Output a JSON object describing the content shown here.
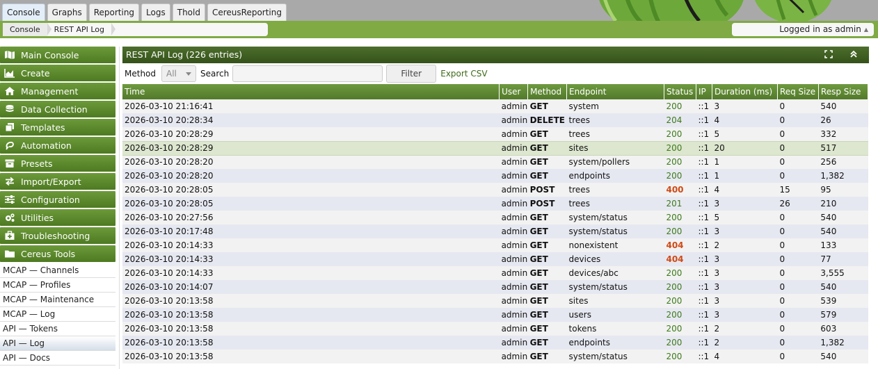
{
  "tabs": [
    "Console",
    "Graphs",
    "Reporting",
    "Logs",
    "Thold",
    "CereusReporting"
  ],
  "breadcrumb": [
    "Console",
    "REST API Log"
  ],
  "login": {
    "text": "Logged in as admin"
  },
  "nav": [
    {
      "label": "Main Console",
      "icon": "map-icon"
    },
    {
      "label": "Create",
      "icon": "chart-area-icon"
    },
    {
      "label": "Management",
      "icon": "home-icon"
    },
    {
      "label": "Data Collection",
      "icon": "database-icon"
    },
    {
      "label": "Templates",
      "icon": "clone-icon"
    },
    {
      "label": "Automation",
      "icon": "automation-icon"
    },
    {
      "label": "Presets",
      "icon": "archive-icon"
    },
    {
      "label": "Import/Export",
      "icon": "exchange-icon"
    },
    {
      "label": "Configuration",
      "icon": "sliders-icon"
    },
    {
      "label": "Utilities",
      "icon": "cogs-icon"
    },
    {
      "label": "Troubleshooting",
      "icon": "medkit-icon"
    },
    {
      "label": "Cereus Tools",
      "icon": "folder-icon"
    }
  ],
  "subnav": [
    "MCAP — Channels",
    "MCAP — Profiles",
    "MCAP — Maintenance",
    "MCAP — Log",
    "API — Tokens",
    "API — Log",
    "API — Docs"
  ],
  "panel": {
    "title": "REST API Log (226 entries)"
  },
  "filter": {
    "method_label": "Method",
    "method_value": "All",
    "search_label": "Search",
    "search_value": "",
    "filter_button": "Filter",
    "export_link": "Export CSV"
  },
  "columns": [
    "Time",
    "User",
    "Method",
    "Endpoint",
    "Status",
    "IP",
    "Duration (ms)",
    "Req Size",
    "Resp Size"
  ],
  "rows": [
    [
      "2026-03-10 21:16:41",
      "admin",
      "GET",
      "system",
      "200",
      "::1",
      "3",
      "0",
      "540"
    ],
    [
      "2026-03-10 20:28:34",
      "admin",
      "DELETE",
      "trees",
      "204",
      "::1",
      "4",
      "0",
      "26"
    ],
    [
      "2026-03-10 20:28:29",
      "admin",
      "GET",
      "trees",
      "200",
      "::1",
      "5",
      "0",
      "332"
    ],
    [
      "2026-03-10 20:28:29",
      "admin",
      "GET",
      "sites",
      "200",
      "::1",
      "20",
      "0",
      "517"
    ],
    [
      "2026-03-10 20:28:20",
      "admin",
      "GET",
      "system/pollers",
      "200",
      "::1",
      "1",
      "0",
      "256"
    ],
    [
      "2026-03-10 20:28:20",
      "admin",
      "GET",
      "endpoints",
      "200",
      "::1",
      "1",
      "0",
      "1,382"
    ],
    [
      "2026-03-10 20:28:05",
      "admin",
      "POST",
      "trees",
      "400",
      "::1",
      "4",
      "15",
      "95"
    ],
    [
      "2026-03-10 20:28:05",
      "admin",
      "POST",
      "trees",
      "201",
      "::1",
      "3",
      "26",
      "210"
    ],
    [
      "2026-03-10 20:27:56",
      "admin",
      "GET",
      "system/status",
      "200",
      "::1",
      "5",
      "0",
      "540"
    ],
    [
      "2026-03-10 20:17:48",
      "admin",
      "GET",
      "system/status",
      "200",
      "::1",
      "3",
      "0",
      "540"
    ],
    [
      "2026-03-10 20:14:33",
      "admin",
      "GET",
      "nonexistent",
      "404",
      "::1",
      "2",
      "0",
      "133"
    ],
    [
      "2026-03-10 20:14:33",
      "admin",
      "GET",
      "devices",
      "404",
      "::1",
      "3",
      "0",
      "77"
    ],
    [
      "2026-03-10 20:14:33",
      "admin",
      "GET",
      "devices/abc",
      "200",
      "::1",
      "3",
      "0",
      "3,555"
    ],
    [
      "2026-03-10 20:14:07",
      "admin",
      "GET",
      "system/status",
      "200",
      "::1",
      "3",
      "0",
      "540"
    ],
    [
      "2026-03-10 20:13:58",
      "admin",
      "GET",
      "sites",
      "200",
      "::1",
      "3",
      "0",
      "539"
    ],
    [
      "2026-03-10 20:13:58",
      "admin",
      "GET",
      "users",
      "200",
      "::1",
      "3",
      "0",
      "579"
    ],
    [
      "2026-03-10 20:13:58",
      "admin",
      "GET",
      "tokens",
      "200",
      "::1",
      "2",
      "0",
      "603"
    ],
    [
      "2026-03-10 20:13:58",
      "admin",
      "GET",
      "endpoints",
      "200",
      "::1",
      "2",
      "0",
      "1,382"
    ],
    [
      "2026-03-10 20:13:58",
      "admin",
      "GET",
      "system/status",
      "200",
      "::1",
      "4",
      "0",
      "540"
    ]
  ],
  "colors": {
    "accent_green": "#5a8630",
    "status_ok": "#3d7a1a",
    "status_error": "#d04a16"
  }
}
